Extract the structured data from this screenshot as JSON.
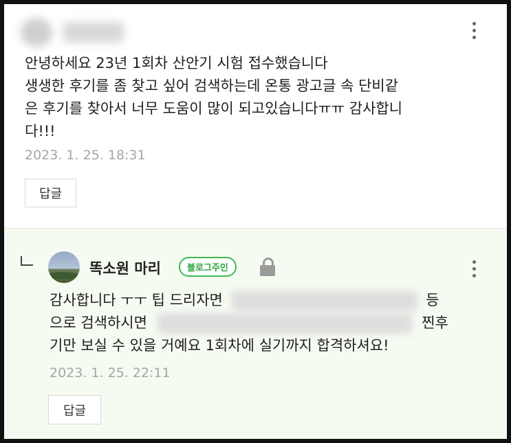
{
  "comments": [
    {
      "text_lines": [
        "안녕하세요 23년 1회차 산안기 시험 접수했습니다",
        "생생한 후기를 좀 찾고 싶어 검색하는데 온통 광고글 속 단비같",
        "은 후기를 찾아서 너무 도움이 많이 되고있습니다ㅠㅠ 감사합니",
        "다!!!"
      ],
      "date": "2023. 1. 25. 18:31",
      "reply_label": "답글"
    },
    {
      "author": "똑소원 마리",
      "badge": "블로그주인",
      "line1_start": "감사합니다 ㅜㅜ 팁 드리자면",
      "line1_end": "등",
      "line2_start": "으로 검색하시면",
      "line2_end": "찐후",
      "line3": "기만 보실 수 있을 거예요 1회차에 실기까지 합격하셔요!",
      "date": "2023. 1. 25. 22:11",
      "reply_label": "답글"
    }
  ],
  "colors": {
    "badge_green": "#3dbb4d",
    "reply_bg": "#f6fbf2",
    "date_gray": "#a5a5a5"
  },
  "icons": [
    "more-vertical-icon",
    "reply-arrow-icon",
    "lock-icon"
  ]
}
